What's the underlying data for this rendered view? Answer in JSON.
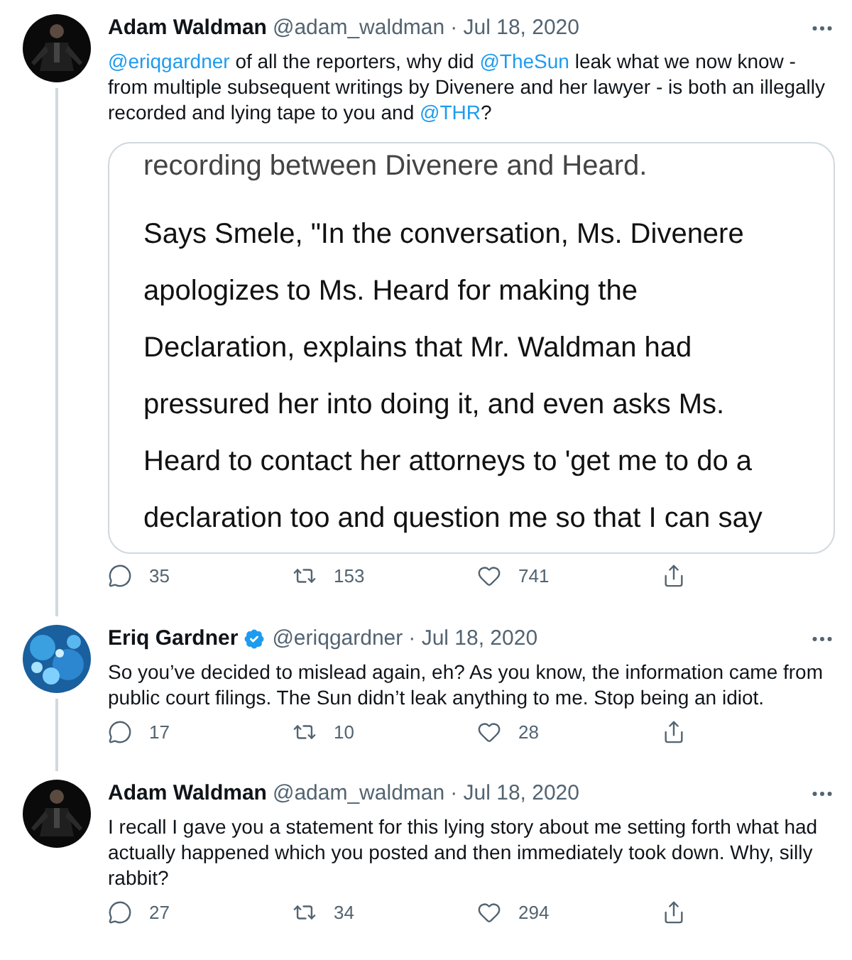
{
  "tweets": [
    {
      "name": "Adam Waldman",
      "verified": false,
      "handle": "@adam_waldman",
      "date": "· Jul 18, 2020",
      "thread_line": true,
      "text": [
        {
          "kind": "mention",
          "text": "@eriqgardner"
        },
        {
          "kind": "plain",
          "text": " of all the reporters, why did "
        },
        {
          "kind": "mention",
          "text": "@TheSun"
        },
        {
          "kind": "plain",
          "text": " leak what we now know - from multiple subsequent writings by Divenere and her lawyer - is both an illegally recorded and lying tape to you and "
        },
        {
          "kind": "mention",
          "text": "@THR"
        },
        {
          "kind": "plain",
          "text": "?"
        }
      ],
      "attachment": {
        "lines": [
          "recording between Divenere and Heard.",
          "Says Smele, \"In the conversation, Ms. Divenere",
          "apologizes to Ms. Heard for making the",
          "Declaration, explains that Mr. Waldman had",
          "pressured her into doing it, and even asks Ms.",
          "Heard to contact her attorneys to 'get me to do a",
          "declaration too and question me so that I can say"
        ]
      },
      "replies": "35",
      "retweets": "153",
      "likes": "741"
    },
    {
      "name": "Eriq Gardner",
      "verified": true,
      "handle": "@eriqgardner",
      "date": "· Jul 18, 2020",
      "thread_line": true,
      "text": [
        {
          "kind": "plain",
          "text": "So you’ve decided to mislead again, eh? As you know, the information came from public court filings. The Sun didn’t leak anything to me. Stop being an idiot."
        }
      ],
      "replies": "17",
      "retweets": "10",
      "likes": "28"
    },
    {
      "name": "Adam Waldman",
      "verified": false,
      "handle": "@adam_waldman",
      "date": "· Jul 18, 2020",
      "thread_line": false,
      "text": [
        {
          "kind": "plain",
          "text": "I recall I gave you a statement for this lying story about me setting forth what had actually happened which you posted and then immediately took down. Why, silly rabbit?"
        }
      ],
      "replies": "27",
      "retweets": "34",
      "likes": "294"
    }
  ]
}
